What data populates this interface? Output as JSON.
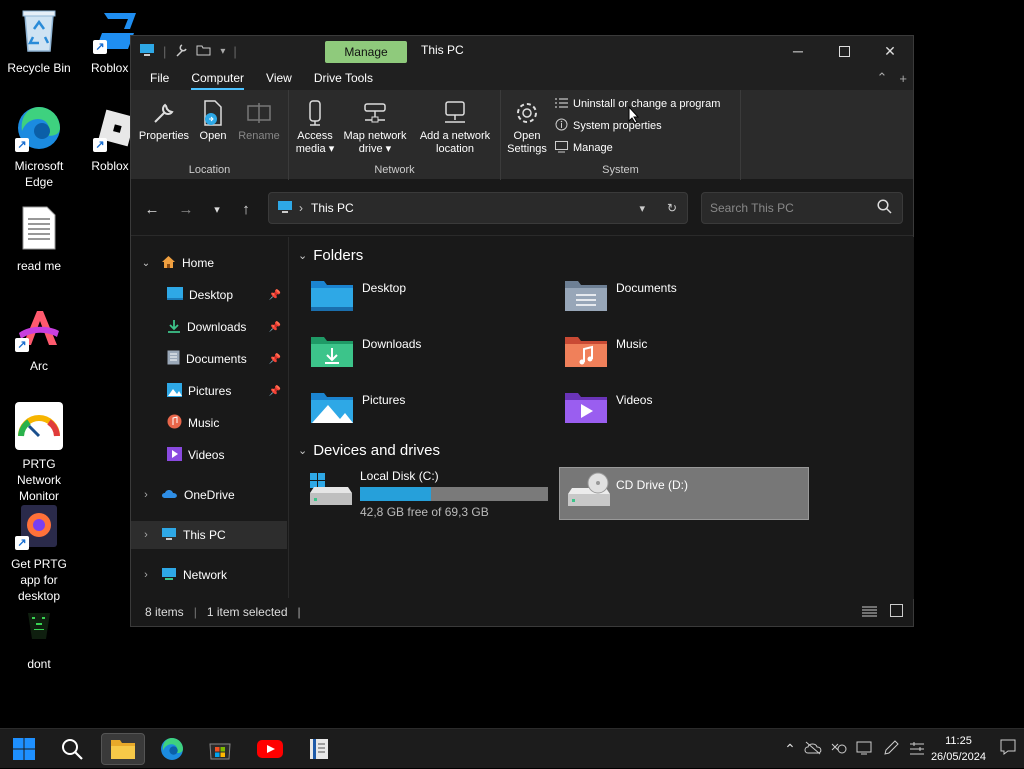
{
  "desktop": {
    "icons": [
      {
        "label": "Recycle Bin"
      },
      {
        "label": "Roblox St"
      },
      {
        "label": "Microsoft Edge"
      },
      {
        "label": "Roblox Pl"
      },
      {
        "label": "read me"
      },
      {
        "label": "Arc"
      },
      {
        "label": "PRTG Network Monitor"
      },
      {
        "label": "Get PRTG app for desktop"
      },
      {
        "label": "dont"
      }
    ]
  },
  "window": {
    "context_tab": "Manage",
    "title": "This PC",
    "menu": [
      "File",
      "Computer",
      "View",
      "Drive Tools"
    ],
    "ribbon": {
      "location": {
        "label": "Location",
        "buttons": [
          "Properties",
          "Open",
          "Rename"
        ]
      },
      "network": {
        "label": "Network",
        "access_media": "Access media",
        "map_drive": "Map network drive",
        "add_location": "Add a network location"
      },
      "system": {
        "label": "System",
        "open_settings": "Open Settings",
        "uninstall": "Uninstall or change a program",
        "system_properties": "System properties",
        "manage": "Manage"
      }
    },
    "address": {
      "path": "This PC"
    },
    "search": {
      "placeholder": "Search This PC"
    },
    "sidebar": {
      "home": "Home",
      "items": [
        "Desktop",
        "Downloads",
        "Documents",
        "Pictures",
        "Music",
        "Videos"
      ],
      "onedrive": "OneDrive",
      "this_pc": "This PC",
      "network": "Network"
    },
    "content": {
      "folders_heading": "Folders",
      "folders": [
        "Desktop",
        "Documents",
        "Downloads",
        "Music",
        "Pictures",
        "Videos"
      ],
      "devices_heading": "Devices and drives",
      "drives": [
        {
          "name": "Local Disk (C:)",
          "space": "42,8 GB free of 69,3 GB",
          "used_fraction": 0.38
        },
        {
          "name": "CD Drive (D:)"
        }
      ]
    },
    "status": {
      "items": "8 items",
      "selected": "1 item selected"
    }
  },
  "taskbar": {
    "time": "11:25",
    "date": "26/05/2024"
  },
  "colors": {
    "accent": "#4cc2ff",
    "drive_bar": "#26a0da",
    "context_tab": "#8fca7c"
  }
}
